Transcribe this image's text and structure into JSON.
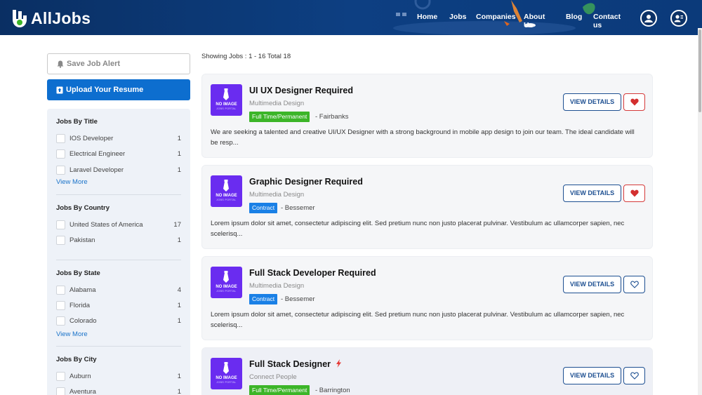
{
  "header": {
    "brand": "AllJobs",
    "nav": [
      "Home",
      "Jobs",
      "Companies",
      "About Us",
      "Blog",
      "Contact us"
    ]
  },
  "sidebar": {
    "save_alert_label": "Save Job Alert",
    "upload_resume_label": "Upload Your Resume",
    "groups": [
      {
        "title": "Jobs By Title",
        "items": [
          {
            "label": "IOS Developer",
            "count": "1"
          },
          {
            "label": "Electrical Engineer",
            "count": "1"
          },
          {
            "label": "Laravel Developer",
            "count": "1"
          }
        ],
        "more": "View More"
      },
      {
        "title": "Jobs By Country",
        "items": [
          {
            "label": "United States of America",
            "count": "17"
          },
          {
            "label": "Pakistan",
            "count": "1"
          }
        ],
        "more": ""
      },
      {
        "title": "Jobs By State",
        "items": [
          {
            "label": "Alabama",
            "count": "4"
          },
          {
            "label": "Florida",
            "count": "1"
          },
          {
            "label": "Colorado",
            "count": "1"
          }
        ],
        "more": "View More"
      },
      {
        "title": "Jobs By City",
        "items": [
          {
            "label": "Auburn",
            "count": "1"
          },
          {
            "label": "Aventura",
            "count": "1"
          }
        ],
        "more": ""
      }
    ]
  },
  "main": {
    "showing": "Showing Jobs : 1 - 16 Total 18",
    "thumb_line1": "NO IMAGE",
    "thumb_line2": "JOBS PORTAL",
    "view_details_label": "VIEW DETAILS",
    "jobs": [
      {
        "title": "UI UX Designer Required",
        "company": "Multimedia Design",
        "type": "Full Time/Permanent",
        "location": "- Fairbanks",
        "description": "We are seeking a talented and creative UI/UX Designer with a strong background in mobile app design to join our team. The ideal candidate will be resp...",
        "liked": true
      },
      {
        "title": "Graphic Designer Required",
        "company": "Multimedia Design",
        "type": "Contract",
        "location": "- Bessemer",
        "description": "Lorem ipsum dolor sit amet, consectetur adipiscing elit. Sed pretium nunc non justo placerat pulvinar. Vestibulum ac ullamcorper sapien, nec scelerisq...",
        "liked": true
      },
      {
        "title": "Full Stack Developer Required",
        "company": "Multimedia Design",
        "type": "Contract",
        "location": "- Bessemer",
        "description": "Lorem ipsum dolor sit amet, consectetur adipiscing elit. Sed pretium nunc non justo placerat pulvinar. Vestibulum ac ullamcorper sapien, nec scelerisq...",
        "liked": false
      },
      {
        "title": "Full Stack Designer",
        "company": "Connect People",
        "type": "Full Time/Permanent",
        "location": "- Barrington",
        "description": "",
        "liked": false,
        "featured": true
      }
    ]
  },
  "colors": {
    "header": "#0b3a7a",
    "accent": "#0d6ecf",
    "full_time": "#3cb528",
    "contract": "#1a80e6",
    "thumb": "#6a2cf0",
    "liked": "#d53a3a"
  }
}
